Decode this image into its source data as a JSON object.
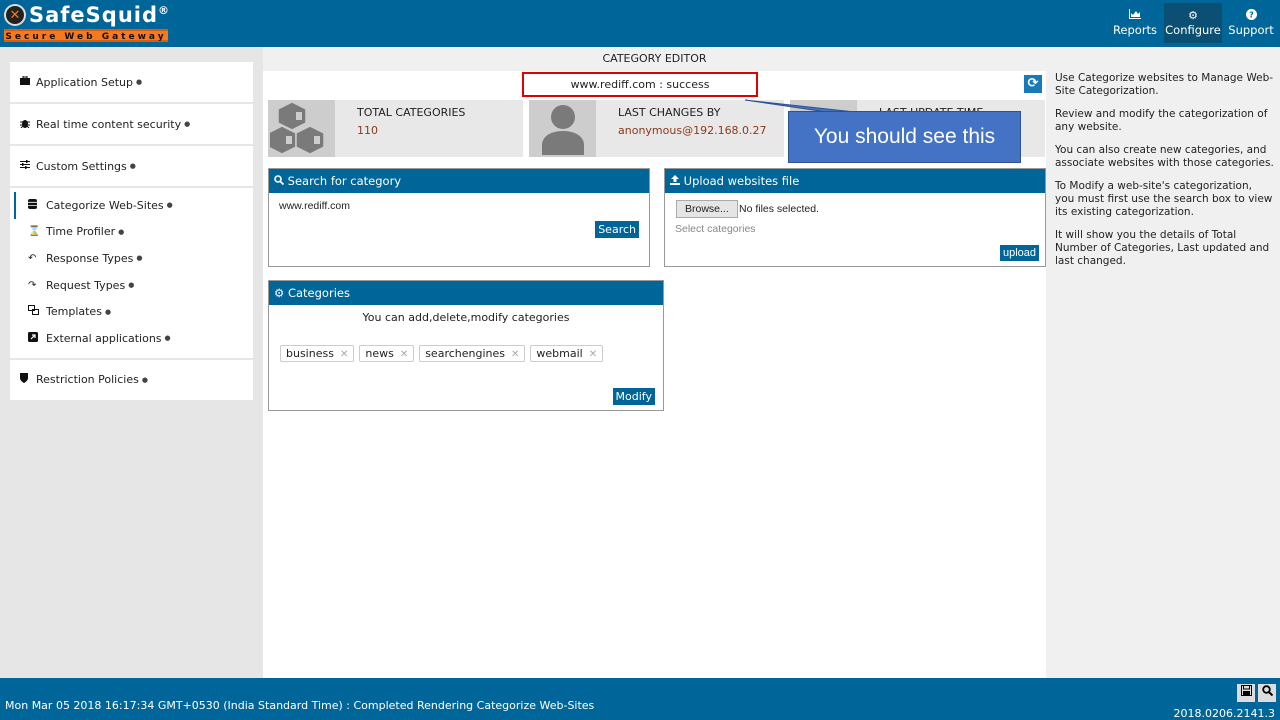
{
  "header": {
    "logo_text": "SafeSquid",
    "logo_reg": "®",
    "logo_tagline": "Secure Web Gateway",
    "nav": [
      {
        "label": "Reports",
        "icon": "chart-icon",
        "active": false
      },
      {
        "label": "Configure",
        "icon": "cogs-icon",
        "active": true
      },
      {
        "label": "Support",
        "icon": "help-icon",
        "active": false
      }
    ]
  },
  "sidebar": {
    "groups": [
      {
        "label": "Application Setup",
        "icon": "briefcase-icon"
      },
      {
        "label": "Real time content security",
        "icon": "bug-icon"
      },
      {
        "label": "Custom Settings",
        "icon": "sliders-icon"
      }
    ],
    "sub_items": [
      {
        "label": "Categorize Web-Sites",
        "icon": "database-icon",
        "active": true
      },
      {
        "label": "Time Profiler",
        "icon": "hourglass-icon"
      },
      {
        "label": "Response Types",
        "icon": "reply-icon"
      },
      {
        "label": "Request Types",
        "icon": "share-icon"
      },
      {
        "label": "Templates",
        "icon": "object-group-icon"
      },
      {
        "label": "External applications",
        "icon": "external-link-icon"
      }
    ],
    "bottom_group": {
      "label": "Restriction Policies",
      "icon": "shield-icon"
    }
  },
  "main": {
    "title": "CATEGORY EDITOR",
    "message": "www.rediff.com : success",
    "stats": [
      {
        "label": "TOTAL CATEGORIES",
        "value": "110",
        "icon": "cubes-icon"
      },
      {
        "label": "LAST CHANGES BY",
        "value": "anonymous@192.168.0.27",
        "icon": "user-icon"
      },
      {
        "label": "LAST UPDATE TIME",
        "value": "",
        "icon": "clock-icon"
      }
    ],
    "search_panel": {
      "title": "Search for category",
      "input_value": "www.rediff.com",
      "button": "Search"
    },
    "upload_panel": {
      "title": "Upload websites file",
      "browse_label": "Browse...",
      "file_status": "No files selected.",
      "select_placeholder": "Select categories",
      "button": "upload"
    },
    "categories_panel": {
      "title": "Categories",
      "hint": "You can add,delete,modify categories",
      "tags": [
        "business",
        "news",
        "searchengines",
        "webmail"
      ],
      "button": "Modify"
    }
  },
  "callout": {
    "text": "You should see this"
  },
  "help": {
    "paragraphs": [
      "Use Categorize websites to Manage Web-Site Categorization.",
      "Review and modify the categorization of any website.",
      "You can also create new categories, and associate websites with those categories.",
      "To Modify a web-site's categorization, you must first use the search box to view its existing categorization.",
      "It will show you the details of Total Number of Categories, Last updated and last changed."
    ]
  },
  "footer": {
    "status": "Mon Mar 05 2018 16:17:34 GMT+0530 (India Standard Time) : Completed Rendering Categorize Web-Sites",
    "version": "2018.0206.2141.3"
  }
}
